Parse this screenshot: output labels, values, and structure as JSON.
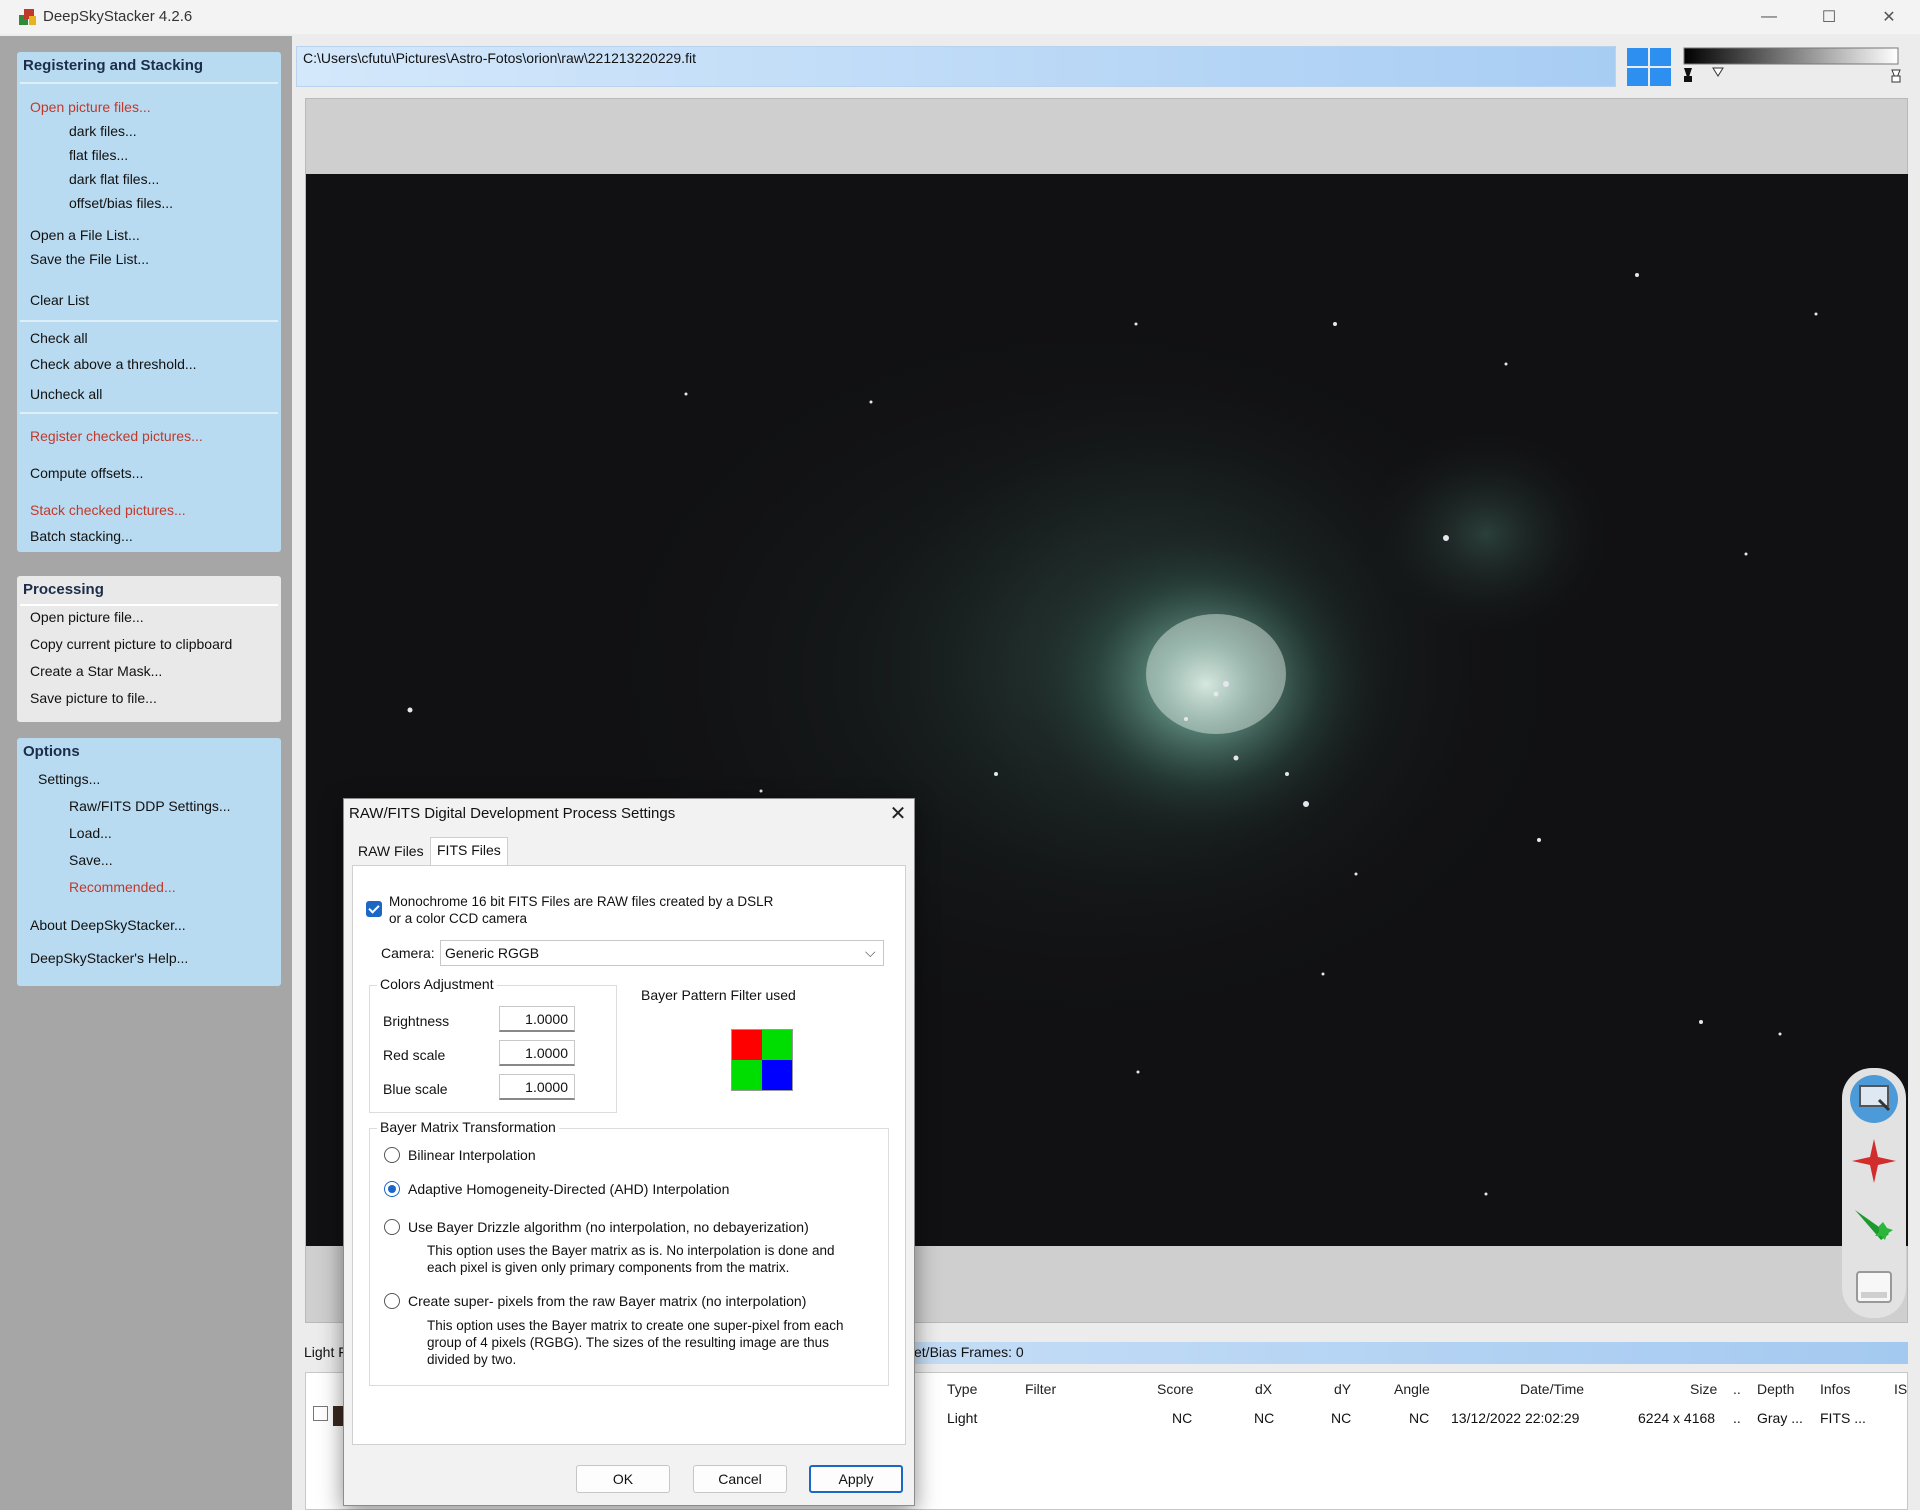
{
  "window": {
    "title": "DeepSkyStacker 4.2.6",
    "minimize_glyph": "—",
    "maximize_glyph": "☐",
    "close_glyph": "✕"
  },
  "sidebar": {
    "registering": {
      "header": "Registering and Stacking",
      "open_picture_files": "Open picture files...",
      "dark_files": "dark files...",
      "flat_files": "flat files...",
      "dark_flat_files": "dark flat files...",
      "offset_bias_files": "offset/bias files...",
      "open_file_list": "Open a File List...",
      "save_file_list": "Save the File List...",
      "clear_list": "Clear List",
      "check_all": "Check all",
      "check_threshold": "Check above a threshold...",
      "uncheck_all": "Uncheck all",
      "register_checked": "Register checked pictures...",
      "compute_offsets": "Compute offsets...",
      "stack_checked": "Stack checked pictures...",
      "batch_stacking": "Batch stacking..."
    },
    "processing": {
      "header": "Processing",
      "open_picture_file": "Open picture file...",
      "copy_clipboard": "Copy current picture to clipboard",
      "star_mask": "Create a Star Mask...",
      "save_picture": "Save picture to file..."
    },
    "options": {
      "header": "Options",
      "settings": "Settings...",
      "raw_fits_settings": "Raw/FITS DDP Settings...",
      "load": "Load...",
      "save": "Save...",
      "recommended": "Recommended...",
      "about": "About DeepSkyStacker...",
      "help": "DeepSkyStacker's Help..."
    }
  },
  "path_bar": {
    "path": "C:\\Users\\cfutu\\Pictures\\Astro-Fotos\\orion\\raw\\221213220229.fit"
  },
  "colors": {
    "accent": "#1a67c6",
    "sidebar_blue": "#b9dbf1",
    "red_menu": "#c0392b"
  },
  "file_list": {
    "light_label": "Light F",
    "frames_summary": "et/Bias Frames: 0",
    "columns": [
      "Type",
      "Filter",
      "Score",
      "dX",
      "dY",
      "Angle",
      "Date/Time",
      "Size",
      "..",
      "Depth",
      "Infos",
      "IS"
    ],
    "rows": [
      {
        "type": "Light",
        "filter": "",
        "score": "NC",
        "dx": "NC",
        "dy": "NC",
        "angle": "NC",
        "datetime": "13/12/2022 22:02:29",
        "size": "6224 x 4168",
        "dots": "..",
        "depth": "Gray ...",
        "infos": "FITS ..."
      }
    ]
  },
  "dialog": {
    "title": "RAW/FITS Digital Development Process Settings",
    "tabs": [
      "RAW Files",
      "FITS Files"
    ],
    "active_tab": "FITS Files",
    "mono_checkbox_line1": "Monochrome 16 bit FITS Files are RAW files created by a DSLR",
    "mono_checkbox_line2": "or a color CCD camera",
    "mono_checked": true,
    "camera_label": "Camera:",
    "camera_value": "Generic RGGB",
    "colors_adjustment": "Colors Adjustment",
    "brightness_label": "Brightness",
    "brightness_value": "1.0000",
    "red_scale_label": "Red scale",
    "red_scale_value": "1.0000",
    "blue_scale_label": "Blue scale",
    "blue_scale_value": "1.0000",
    "bayer_pattern_label": "Bayer Pattern Filter used",
    "bayer_colors": [
      "#ff0000",
      "#00dd00",
      "#00dd00",
      "#0000ff"
    ],
    "bayer_matrix_title": "Bayer Matrix Transformation",
    "opt_bilinear": "Bilinear Interpolation",
    "opt_ahd": "Adaptive Homogeneity-Directed (AHD) Interpolation",
    "opt_drizzle": "Use Bayer Drizzle algorithm (no interpolation, no debayerization)",
    "opt_drizzle_desc1": "This option uses the Bayer matrix as is. No interpolation is done and",
    "opt_drizzle_desc2": "each pixel is given only primary components from the matrix.",
    "opt_superpixel": "Create super- pixels from the raw Bayer matrix (no interpolation)",
    "opt_superpixel_desc1": "This option uses the Bayer matrix to create one super-pixel from each",
    "opt_superpixel_desc2": "group of 4 pixels (RGBG). The sizes of the resulting image are thus",
    "opt_superpixel_desc3": "divided by two.",
    "selected_option": "opt_ahd",
    "ok": "OK",
    "cancel": "Cancel",
    "apply": "Apply"
  }
}
